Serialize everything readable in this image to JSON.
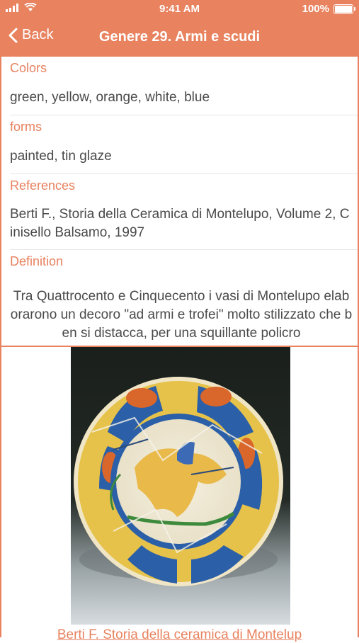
{
  "status_bar": {
    "time": "9:41 AM",
    "battery": "100%"
  },
  "nav": {
    "back_label": "Back",
    "title": "Genere 29. Armi e scudi"
  },
  "details": {
    "colors_label": "Colors",
    "colors_value": "green, yellow, orange, white, blue",
    "forms_label": "forms",
    "forms_value": "painted, tin glaze",
    "references_label": "References",
    "references_value": "Berti F., Storia della Ceramica di Montelupo, Volume 2, Cinisello Balsamo, 1997",
    "definition_label": "Definition",
    "definition_value": "Tra Quattrocento e Cinquecento i vasi di Montelupo elaborarono un decoro \"ad armi e trofei\" molto stilizzato che ben si distacca, per una squillante policro"
  },
  "image": {
    "caption": "Berti F. Storia della ceramica di Montelup"
  },
  "colors": {
    "accent": "#e8825f",
    "text": "#4a4a4a"
  },
  "icons": [
    "signal-icon",
    "wifi-icon",
    "battery-icon",
    "chevron-left-icon"
  ]
}
